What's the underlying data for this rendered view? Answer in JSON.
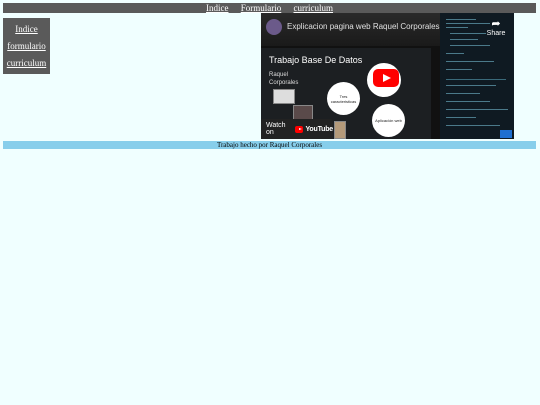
{
  "topnav": {
    "items": [
      {
        "label": "Indice"
      },
      {
        "label": "Formulario"
      },
      {
        "label": "curriculum"
      }
    ]
  },
  "sidenav": {
    "items": [
      {
        "label": "Indice"
      },
      {
        "label": "formulario"
      },
      {
        "label": "curriculum"
      }
    ]
  },
  "video": {
    "title": "Explicacion pagina web Raquel Corporales",
    "share_label": "Share",
    "share_icon": "share-arrow-icon",
    "watch_on_label": "Watch on",
    "youtube_label": "YouTube",
    "slide": {
      "title": "Trabajo Base De Datos",
      "author": "Raquel Corporales",
      "circle_1": "Tres caracteristicas",
      "circle_2": "",
      "circle_3": "Aplicación web"
    }
  },
  "footer": {
    "text": "Trabajo hecho por Raquel Corporales"
  },
  "colors": {
    "nav_bg": "#5a5a5a",
    "page_bg": "#f0ffff",
    "footer_bg": "#87ceeb",
    "play_red": "#ff0000"
  }
}
